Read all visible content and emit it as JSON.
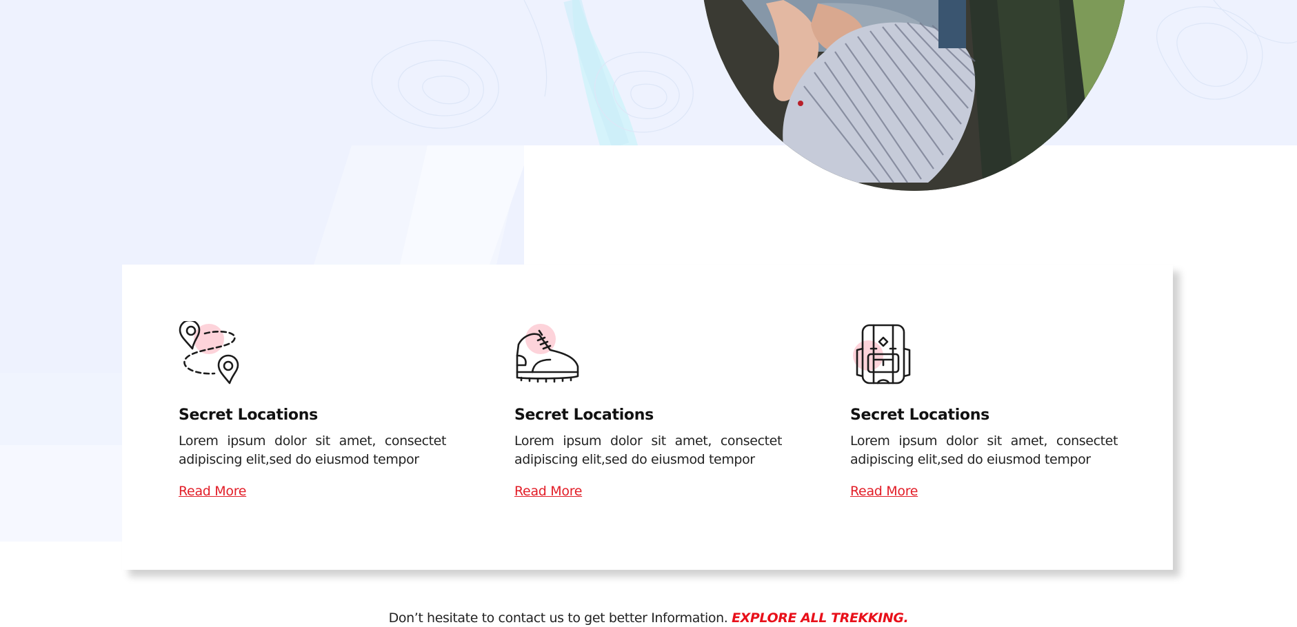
{
  "colors": {
    "accent": "#e21d27",
    "highlight_red": "#e8101a",
    "hero_bg": "#eef2fe",
    "icon_blob": "#fdd3da"
  },
  "hero": {
    "image": "hiker-with-backpack-photo"
  },
  "features": [
    {
      "icon": "map-route-pins-icon",
      "title": "Secret Locations",
      "text": "Lorem ipsum dolor sit amet, consectet adipiscing elit,sed do eiusmod tempor",
      "link": "Read More"
    },
    {
      "icon": "hiking-boot-icon",
      "title": "Secret Locations",
      "text": "Lorem ipsum dolor sit amet, consectet adipiscing elit,sed do eiusmod tempor",
      "link": "Read More"
    },
    {
      "icon": "backpack-icon",
      "title": "Secret Locations",
      "text": "Lorem ipsum dolor sit amet, consectet adipiscing elit,sed do eiusmod tempor",
      "link": "Read More"
    }
  ],
  "cta": {
    "text": "Don’t hesitate to contact us to get better Information.",
    "highlight": "EXPLORE ALL TREKKING."
  }
}
